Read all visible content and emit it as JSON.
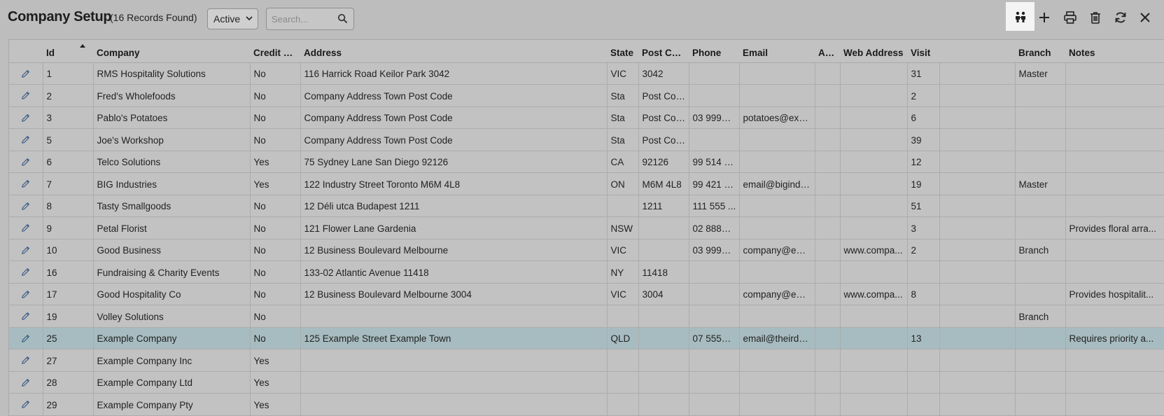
{
  "header": {
    "title": "Company Setup",
    "record_count": "(16 Records Found)",
    "status_filter": "Active",
    "search_placeholder": "Search..."
  },
  "toolbar": [
    "people-icon",
    "add-icon",
    "print-icon",
    "delete-icon",
    "refresh-icon",
    "close-icon"
  ],
  "columns": [
    "",
    "Id",
    "Company",
    "Credit H...",
    "Address",
    "State",
    "Post Cod...",
    "Phone",
    "Email",
    "AB...",
    "Web Address",
    "Visit",
    "",
    "Branch",
    "Notes"
  ],
  "rows": [
    {
      "id": "1",
      "company": "RMS Hospitality Solutions",
      "credit": "No",
      "address": "116 Harrick Road Keilor Park 3042",
      "state": "VIC",
      "post": "3042",
      "phone": "",
      "email": "",
      "ab": "",
      "web": "",
      "visit": "31",
      "extra": "",
      "branch": "Master",
      "notes": ""
    },
    {
      "id": "2",
      "company": "Fred's Wholefoods",
      "credit": "No",
      "address": "Company Address Town Post Code",
      "state": "Sta",
      "post": "Post Code",
      "phone": "",
      "email": "",
      "ab": "",
      "web": "",
      "visit": "2",
      "extra": "",
      "branch": "",
      "notes": ""
    },
    {
      "id": "3",
      "company": "Pablo's Potatoes",
      "credit": "No",
      "address": "Company Address Town Post Code",
      "state": "Sta",
      "post": "Post Code",
      "phone": "03 9999 ...",
      "email": "potatoes@exa...",
      "ab": "",
      "web": "",
      "visit": "6",
      "extra": "",
      "branch": "",
      "notes": ""
    },
    {
      "id": "5",
      "company": "Joe's Workshop",
      "credit": "No",
      "address": "Company Address Town Post Code",
      "state": "Sta",
      "post": "Post Code",
      "phone": "",
      "email": "",
      "ab": "",
      "web": "",
      "visit": "39",
      "extra": "",
      "branch": "",
      "notes": ""
    },
    {
      "id": "6",
      "company": "Telco Solutions",
      "credit": "Yes",
      "address": "75 Sydney Lane San Diego 92126",
      "state": "CA",
      "post": "92126",
      "phone": "99 514 4...",
      "email": "",
      "ab": "",
      "web": "",
      "visit": "12",
      "extra": "",
      "branch": "",
      "notes": ""
    },
    {
      "id": "7",
      "company": "BIG Industries",
      "credit": "Yes",
      "address": "122 Industry Street Toronto M6M 4L8",
      "state": "ON",
      "post": "M6M 4L8",
      "phone": "99 421 2...",
      "email": "email@bigindu...",
      "ab": "",
      "web": "",
      "visit": "19",
      "extra": "",
      "branch": "Master",
      "notes": ""
    },
    {
      "id": "8",
      "company": "Tasty Smallgoods",
      "credit": "No",
      "address": "12 Déli utca Budapest 1211",
      "state": "",
      "post": "1211",
      "phone": "111 555 ...",
      "email": "",
      "ab": "",
      "web": "",
      "visit": "51",
      "extra": "",
      "branch": "",
      "notes": ""
    },
    {
      "id": "9",
      "company": "Petal Florist",
      "credit": "No",
      "address": "121 Flower Lane Gardenia",
      "state": "NSW",
      "post": "",
      "phone": "02 8888 ...",
      "email": "",
      "ab": "",
      "web": "",
      "visit": "3",
      "extra": "",
      "branch": "",
      "notes": "Provides floral arra..."
    },
    {
      "id": "10",
      "company": "Good Business",
      "credit": "No",
      "address": "12 Business Boulevard Melbourne",
      "state": "VIC",
      "post": "",
      "phone": "03 9999 ...",
      "email": "company@em...",
      "ab": "",
      "web": "www.compa...",
      "visit": "2",
      "extra": "",
      "branch": "Branch",
      "notes": ""
    },
    {
      "id": "16",
      "company": "Fundraising & Charity Events",
      "credit": "No",
      "address": "133-02 Atlantic Avenue 11418",
      "state": "NY",
      "post": "11418",
      "phone": "",
      "email": "",
      "ab": "",
      "web": "",
      "visit": "",
      "extra": "",
      "branch": "",
      "notes": ""
    },
    {
      "id": "17",
      "company": "Good Hospitality Co",
      "credit": "No",
      "address": "12 Business Boulevard Melbourne 3004",
      "state": "VIC",
      "post": "3004",
      "phone": "",
      "email": "company@em...",
      "ab": "",
      "web": "www.compa...",
      "visit": "8",
      "extra": "",
      "branch": "",
      "notes": "Provides hospitalit..."
    },
    {
      "id": "19",
      "company": "Volley Solutions",
      "credit": "No",
      "address": "",
      "state": "",
      "post": "",
      "phone": "",
      "email": "",
      "ab": "",
      "web": "",
      "visit": "",
      "extra": "",
      "branch": "Branch",
      "notes": ""
    },
    {
      "id": "25",
      "company": "Example Company",
      "credit": "No",
      "address": "125 Example Street Example Town",
      "state": "QLD",
      "post": "",
      "phone": "07 5550 ...",
      "email": "email@theirdo...",
      "ab": "",
      "web": "",
      "visit": "13",
      "extra": "",
      "branch": "",
      "notes": "Requires priority a...",
      "selected": true
    },
    {
      "id": "27",
      "company": "Example Company Inc",
      "credit": "Yes",
      "address": "",
      "state": "",
      "post": "",
      "phone": "",
      "email": "",
      "ab": "",
      "web": "",
      "visit": "",
      "extra": "",
      "branch": "",
      "notes": ""
    },
    {
      "id": "28",
      "company": "Example Company Ltd",
      "credit": "Yes",
      "address": "",
      "state": "",
      "post": "",
      "phone": "",
      "email": "",
      "ab": "",
      "web": "",
      "visit": "",
      "extra": "",
      "branch": "",
      "notes": ""
    },
    {
      "id": "29",
      "company": "Example Company Pty",
      "credit": "Yes",
      "address": "",
      "state": "",
      "post": "",
      "phone": "",
      "email": "",
      "ab": "",
      "web": "",
      "visit": "",
      "extra": "",
      "branch": "",
      "notes": ""
    }
  ],
  "colors": {
    "selected_row": "#a7bcc0",
    "background": "#bdbdbd",
    "active_tool": "#f4f4f4"
  }
}
